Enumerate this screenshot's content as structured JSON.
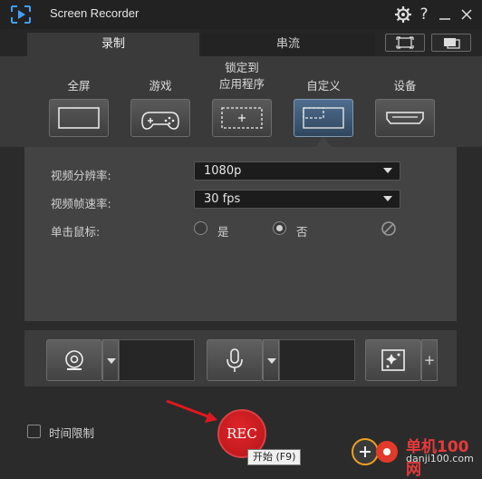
{
  "window": {
    "title": "Screen Recorder"
  },
  "titlebar_icons": [
    "gear-icon",
    "help-icon",
    "minimize-icon",
    "close-icon"
  ],
  "help_glyph": "?",
  "tabs": [
    {
      "label": "录制",
      "active": true
    },
    {
      "label": "串流",
      "active": false
    }
  ],
  "modes": [
    {
      "label": "全屏",
      "icon": "fullscreen-icon",
      "active": false
    },
    {
      "label": "游戏",
      "icon": "gamepad-icon",
      "active": false
    },
    {
      "label": "锁定到\n应用程序",
      "icon": "lock-to-app-icon",
      "active": false
    },
    {
      "label": "自定义",
      "icon": "custom-area-icon",
      "active": true
    },
    {
      "label": "设备",
      "icon": "device-hdmi-icon",
      "active": false
    }
  ],
  "settings": {
    "resolution_label": "视频分辨率:",
    "resolution_value": "1080p",
    "framerate_label": "视频帧速率:",
    "framerate_value": "30 fps",
    "click_label": "单击鼠标:",
    "click_yes": "是",
    "click_no": "否",
    "click_selected": "否"
  },
  "devices": {
    "webcam_icon": "webcam-icon",
    "mic_icon": "microphone-icon",
    "effects_icon": "sparkle-effects-icon",
    "add_glyph": "+"
  },
  "bottom": {
    "time_limit_label": "时间限制",
    "rec_label": "REC",
    "tooltip": "开始 (F9)"
  },
  "watermark": {
    "line1": "单机100网",
    "line2": "danji100.com"
  },
  "colors": {
    "accent_active": "#4f6d8e",
    "rec_red": "#c8181d",
    "arrow_red": "#e0181e"
  }
}
